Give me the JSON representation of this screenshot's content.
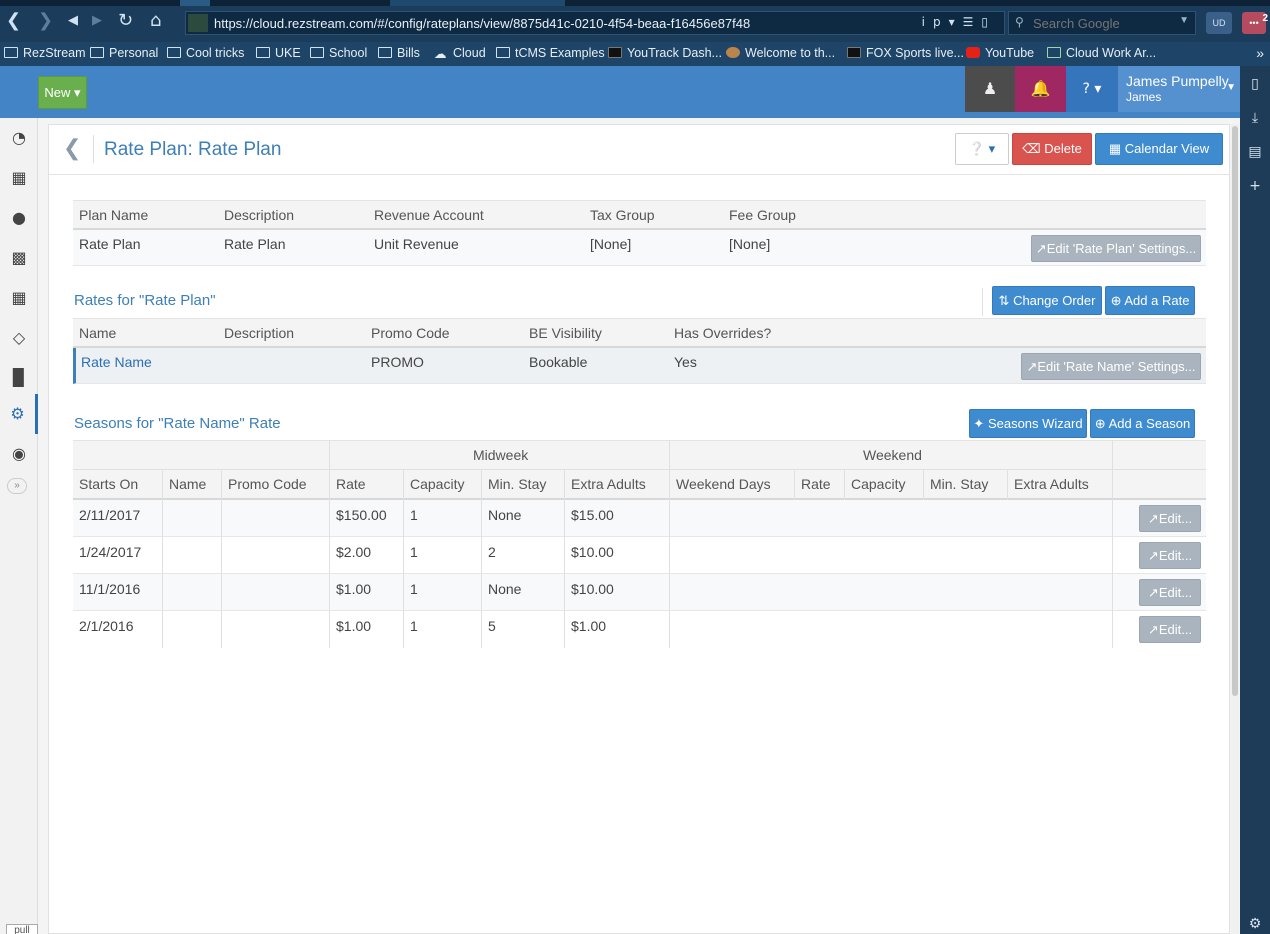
{
  "browser": {
    "url": "https://cloud.rezstream.com/#/config/rateplans/view/8875d41c-0210-4f54-beaa-f16456e87f48",
    "search_placeholder": "Search Google",
    "ext_badge": "2",
    "bookmarks": [
      "RezStream",
      "Personal",
      "Cool tricks",
      "UKE",
      "School",
      "Bills",
      "Cloud",
      "tCMS Examples",
      "YouTrack Dash...",
      "Welcome to th...",
      "FOX Sports live...",
      "YouTube",
      "Cloud Work Ar..."
    ]
  },
  "header": {
    "new_label": "New",
    "user_name": "James Pumpelly",
    "user_sub": "James"
  },
  "page": {
    "title": "Rate Plan: Rate Plan",
    "delete_label": "Delete",
    "calendar_label": "Calendar View"
  },
  "plan": {
    "headers": [
      "Plan Name",
      "Description",
      "Revenue Account",
      "Tax Group",
      "Fee Group"
    ],
    "row": [
      "Rate Plan",
      "Rate Plan",
      "Unit Revenue",
      "[None]",
      "[None]"
    ],
    "edit_label": "Edit 'Rate Plan' Settings..."
  },
  "rates": {
    "title": "Rates for \"Rate Plan\"",
    "change_order_label": "Change Order",
    "add_label": "Add a Rate",
    "headers": [
      "Name",
      "Description",
      "Promo Code",
      "BE Visibility",
      "Has Overrides?"
    ],
    "row": [
      "Rate Name",
      "",
      "PROMO",
      "Bookable",
      "Yes"
    ],
    "edit_label": "Edit 'Rate Name' Settings..."
  },
  "seasons": {
    "title": "Seasons for \"Rate Name\" Rate",
    "wizard_label": "Seasons Wizard",
    "add_label": "Add a Season",
    "group_midweek": "Midweek",
    "group_weekend": "Weekend",
    "headers": [
      "Starts On",
      "Name",
      "Promo Code",
      "Rate",
      "Capacity",
      "Min. Stay",
      "Extra Adults",
      "Weekend Days",
      "Rate",
      "Capacity",
      "Min. Stay",
      "Extra Adults"
    ],
    "rows": [
      {
        "starts": "2/11/2017",
        "rate": "$150.00",
        "capacity": "1",
        "min_stay": "None",
        "extra": "$15.00"
      },
      {
        "starts": "1/24/2017",
        "rate": "$2.00",
        "capacity": "1",
        "min_stay": "2",
        "extra": "$10.00"
      },
      {
        "starts": "11/1/2016",
        "rate": "$1.00",
        "capacity": "1",
        "min_stay": "None",
        "extra": "$10.00"
      },
      {
        "starts": "2/1/2016",
        "rate": "$1.00",
        "capacity": "1",
        "min_stay": "5",
        "extra": "$1.00"
      }
    ],
    "edit_label": "Edit..."
  },
  "misc": {
    "pull_label": "pull"
  }
}
